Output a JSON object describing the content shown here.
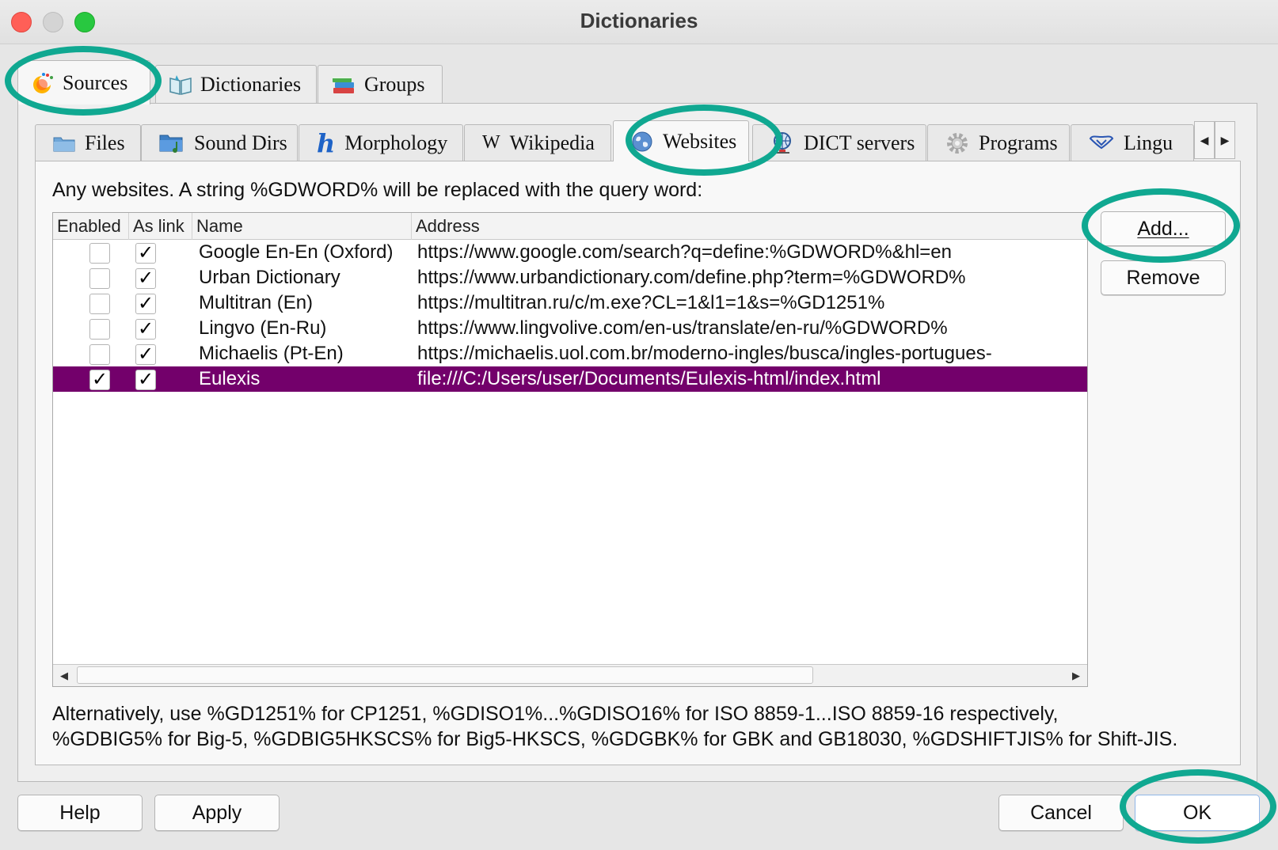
{
  "window": {
    "title": "Dictionaries"
  },
  "main_tabs": [
    {
      "label": "Sources",
      "icon": "sources-icon",
      "active": true
    },
    {
      "label": "Dictionaries",
      "icon": "book-icon",
      "active": false
    },
    {
      "label": "Groups",
      "icon": "books-stack-icon",
      "active": false
    }
  ],
  "sub_tabs": [
    {
      "label": "Files",
      "icon": "folder-icon"
    },
    {
      "label": "Sound Dirs",
      "icon": "sound-folder-icon"
    },
    {
      "label": "Morphology",
      "icon": "h-letter-icon"
    },
    {
      "label": "Wikipedia",
      "icon": "wikipedia-w-icon"
    },
    {
      "label": "Websites",
      "icon": "globe-icon",
      "active": true
    },
    {
      "label": "DICT servers",
      "icon": "network-globe-icon"
    },
    {
      "label": "Programs",
      "icon": "gear-icon"
    },
    {
      "label": "Lingu",
      "icon": "lingualibre-icon"
    }
  ],
  "websites": {
    "description": "Any websites. A string %GDWORD% will be replaced with the query word:",
    "columns": [
      "Enabled",
      "As link",
      "Name",
      "Address"
    ],
    "rows": [
      {
        "enabled": false,
        "as_link": true,
        "name": "Google En-En (Oxford)",
        "address": "https://www.google.com/search?q=define:%GDWORD%&hl=en"
      },
      {
        "enabled": false,
        "as_link": true,
        "name": "Urban Dictionary",
        "address": "https://www.urbandictionary.com/define.php?term=%GDWORD%"
      },
      {
        "enabled": false,
        "as_link": true,
        "name": "Multitran (En)",
        "address": "https://multitran.ru/c/m.exe?CL=1&l1=1&s=%GD1251%"
      },
      {
        "enabled": false,
        "as_link": true,
        "name": "Lingvo (En-Ru)",
        "address": "https://www.lingvolive.com/en-us/translate/en-ru/%GDWORD%"
      },
      {
        "enabled": false,
        "as_link": true,
        "name": "Michaelis (Pt-En)",
        "address": "https://michaelis.uol.com.br/moderno-ingles/busca/ingles-portugues-"
      },
      {
        "enabled": true,
        "as_link": true,
        "name": "Eulexis",
        "address": "file:///C:/Users/user/Documents/Eulexis-html/index.html",
        "selected": true
      }
    ],
    "add_label": "Add...",
    "remove_label": "Remove",
    "note_line1": "Alternatively, use %GD1251% for CP1251, %GDISO1%...%GDISO16% for ISO 8859-1...ISO 8859-16 respectively,",
    "note_line2": "%GDBIG5% for Big-5, %GDBIG5HKSCS% for Big5-HKSCS, %GDGBK% for GBK and GB18030, %GDSHIFTJIS% for Shift-JIS."
  },
  "buttons": {
    "help": "Help",
    "apply": "Apply",
    "cancel": "Cancel",
    "ok": "OK"
  },
  "colors": {
    "selection": "#73006b",
    "highlight_ring": "#10a891"
  }
}
